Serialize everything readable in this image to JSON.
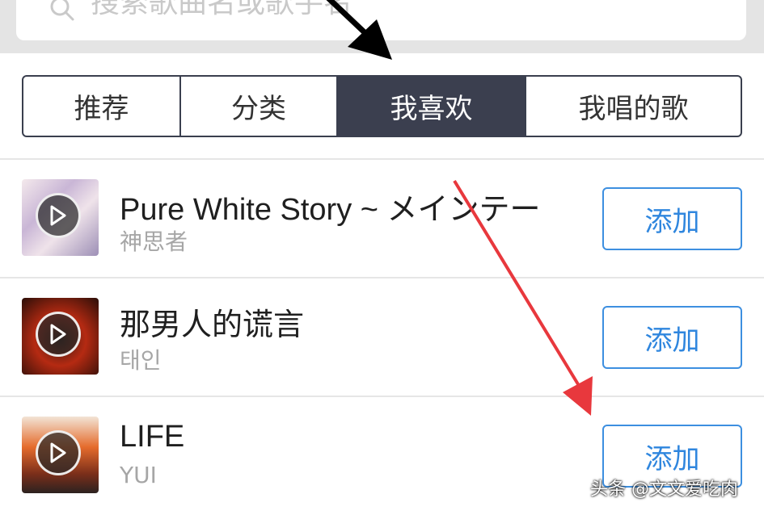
{
  "search": {
    "placeholder": "搜索歌曲名或歌手名"
  },
  "tabs": [
    {
      "label": "推荐"
    },
    {
      "label": "分类"
    },
    {
      "label": "我喜欢"
    },
    {
      "label": "我唱的歌"
    }
  ],
  "active_tab": "我喜欢",
  "songs": [
    {
      "title": "Pure White Story ~ メインテー",
      "artist": "神思者",
      "action": "添加"
    },
    {
      "title": "那男人的谎言",
      "artist": "태인",
      "action": "添加"
    },
    {
      "title": "LIFE",
      "artist": "YUI",
      "action": "添加"
    }
  ],
  "watermark": "头条 @文文爱吃肉",
  "colors": {
    "active_tab_bg": "#3b3f4f",
    "button_accent": "#2f86de",
    "annotation_arrow_red": "#e8383d",
    "annotation_arrow_black": "#000000"
  },
  "icons": [
    "search-icon",
    "play-icon",
    "arrow-annotation"
  ]
}
